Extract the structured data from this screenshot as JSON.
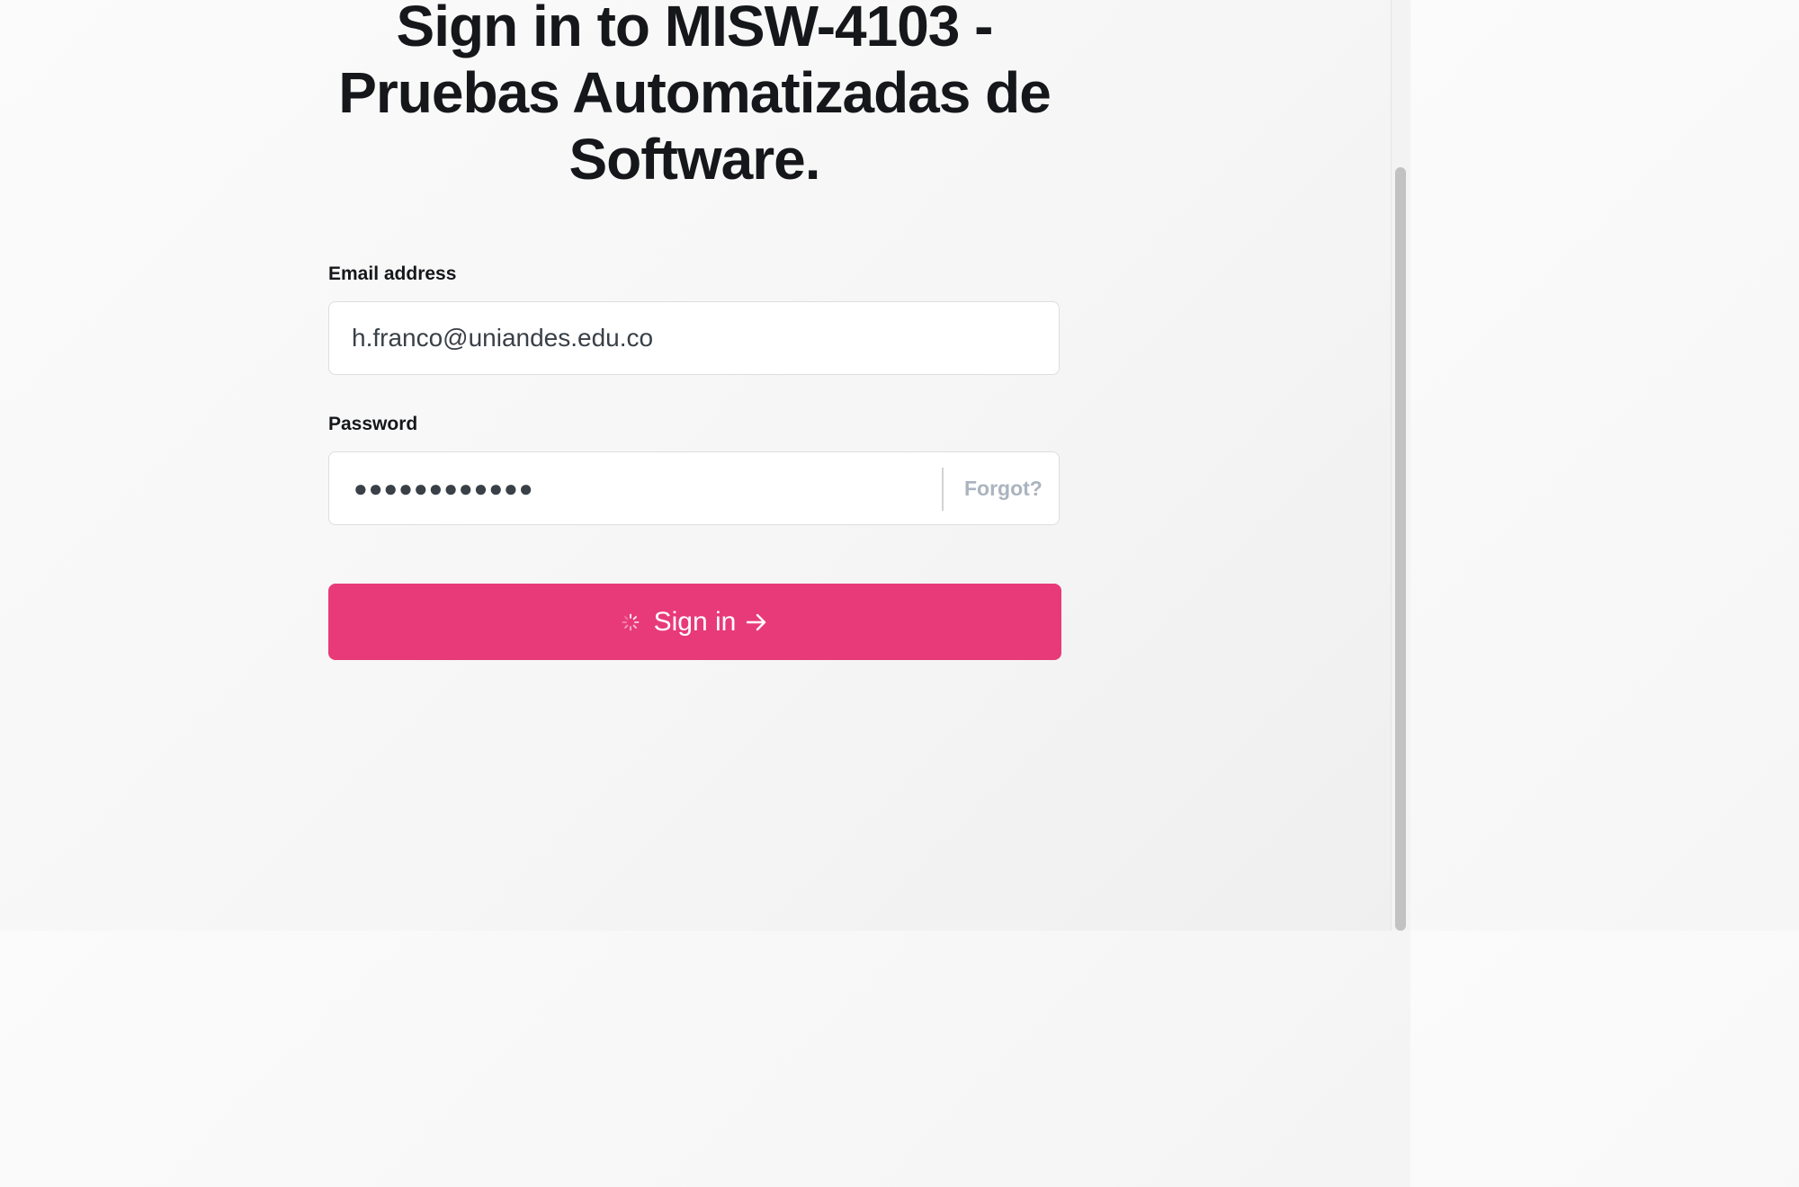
{
  "page": {
    "title": "Sign in to MISW-4103 - Pruebas Automatizadas de Software."
  },
  "form": {
    "email_label": "Email address",
    "email_value": "h.franco@uniandes.edu.co",
    "password_label": "Password",
    "password_masked": "●●●●●●●●●●●●",
    "forgot_label": "Forgot?",
    "signin_label": "Sign in"
  },
  "icons": {
    "spinner": "loading-spinner-icon",
    "arrow": "arrow-right-icon"
  },
  "colors": {
    "accent": "#e83a78",
    "title_text": "#15171a",
    "forgot_text": "#abb4be"
  }
}
